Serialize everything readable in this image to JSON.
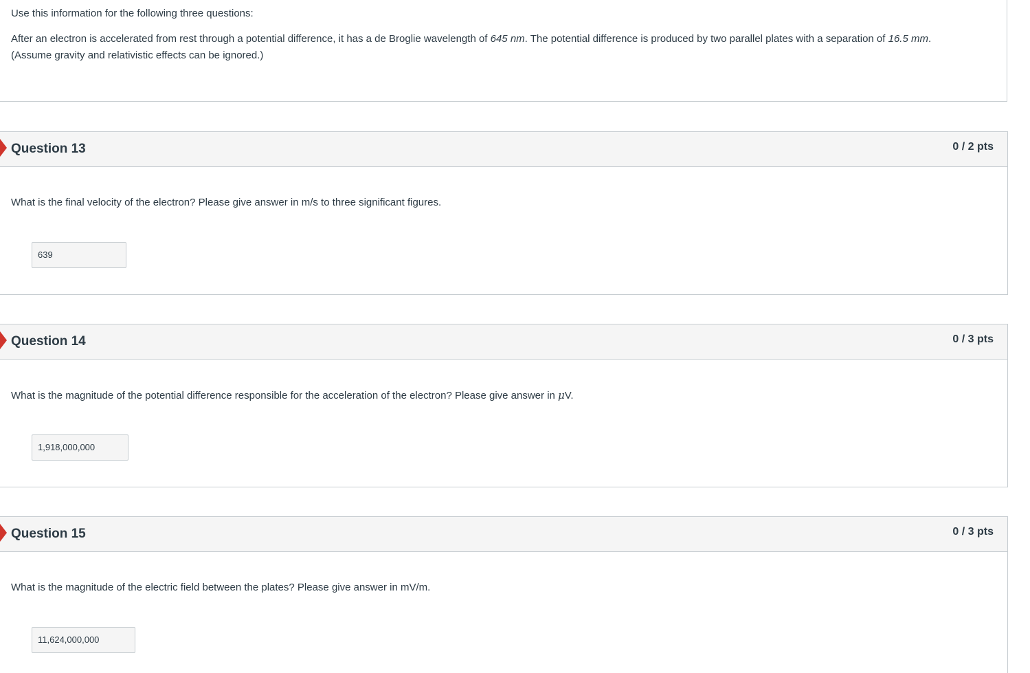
{
  "info": {
    "intro": "Use this information for the following three questions:",
    "body_part1": "After an electron is accelerated from rest through a potential difference, it has a de Broglie wavelength of ",
    "wavelength": "645 nm",
    "body_part2": ". The potential difference is produced by two parallel plates with a separation of ",
    "separation": "16.5 mm",
    "body_part3": ".",
    "body_line2": "(Assume gravity and relativistic effects can be ignored.)"
  },
  "questions": [
    {
      "title": "Question 13",
      "points": "0 / 2 pts",
      "text": "What is the final velocity of the electron? Please give answer in m/s to three significant figures.",
      "answer": "639"
    },
    {
      "title": "Question 14",
      "points": "0 / 3 pts",
      "text_before": "What is the magnitude of the potential difference responsible for the acceleration of the electron? Please give answer in ",
      "unit_symbol": "μ",
      "text_after": "V.",
      "answer": "1,918,000,000"
    },
    {
      "title": "Question 15",
      "points": "0 / 3 pts",
      "text": "What is the magnitude of the electric field between the plates? Please give answer in mV/m.",
      "answer": "11,624,000,000"
    }
  ],
  "colors": {
    "incorrect_flag": "#d0352c",
    "header_bg": "#f5f5f5",
    "border": "#c7cdd1",
    "text": "#2d3b45"
  },
  "icons": {
    "incorrect_flag": "incorrect-answer-flag-icon"
  }
}
